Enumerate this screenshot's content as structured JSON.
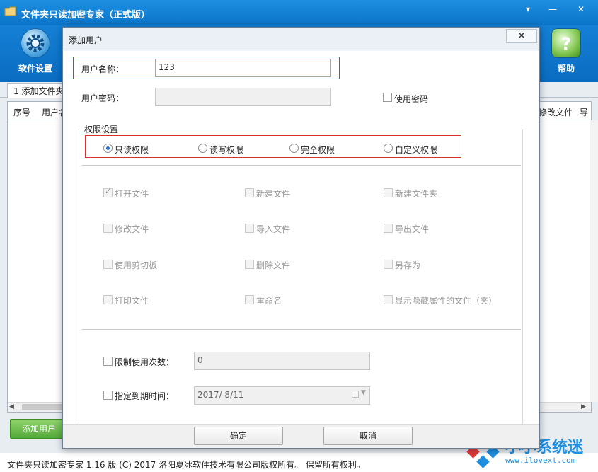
{
  "main_window": {
    "title": "文件夹只读加密专家（正式版）",
    "toolbar": {
      "settings_label": "软件设置",
      "help_label": "帮助"
    },
    "tab_label": "1 添加文件夹",
    "columns": [
      "序号",
      "用户名",
      "修改文件",
      "导"
    ],
    "add_user_label": "添加用户",
    "status_text": "文件夹只读加密专家 1.16 版 (C) 2017 洛阳夏冰软件技术有限公司版权所有。 保留所有权利。"
  },
  "watermark": {
    "brand": "小小系统迷",
    "url": "www.ilovext.com"
  },
  "dialog": {
    "title": "添加用户",
    "close_glyph": "✕",
    "username_label": "用户名称：",
    "username_value": "123",
    "password_label": "用户密码：",
    "password_value": "",
    "use_password_label": "使用密码",
    "permissions_group_label": "权限设置",
    "radios": [
      {
        "label": "只读权限",
        "selected": true
      },
      {
        "label": "读写权限",
        "selected": false
      },
      {
        "label": "完全权限",
        "selected": false
      },
      {
        "label": "自定义权限",
        "selected": false
      }
    ],
    "permission_checks": [
      {
        "label": "打开文件",
        "checked": true
      },
      {
        "label": "新建文件",
        "checked": false
      },
      {
        "label": "新建文件夹",
        "checked": false
      },
      {
        "label": "修改文件",
        "checked": false
      },
      {
        "label": "导入文件",
        "checked": false
      },
      {
        "label": "导出文件",
        "checked": false
      },
      {
        "label": "使用剪切板",
        "checked": false
      },
      {
        "label": "删除文件",
        "checked": false
      },
      {
        "label": "另存为",
        "checked": false
      },
      {
        "label": "打印文件",
        "checked": false
      },
      {
        "label": "重命名",
        "checked": false
      },
      {
        "label": "显示隐藏属性的文件（夹）",
        "checked": false
      }
    ],
    "limit_uses_label": "限制使用次数：",
    "limit_uses_value": "0",
    "expiry_label": "指定到期时间：",
    "expiry_value": "2017/ 8/11",
    "ok_label": "确定",
    "cancel_label": "取消"
  },
  "colors": {
    "title_blue": "#0a74c8",
    "highlight_red": "#d8322f",
    "add_user_green": "#55a93a"
  }
}
